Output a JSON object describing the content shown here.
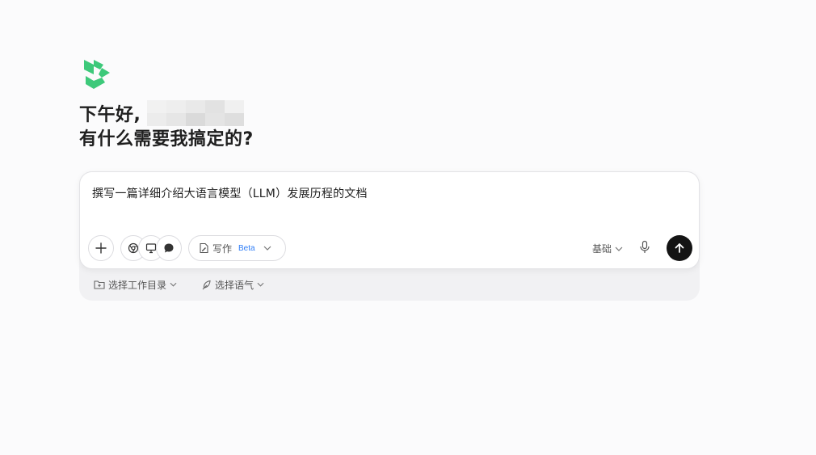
{
  "greeting": {
    "line1": "下午好,",
    "line2": "有什么需要我搞定的?"
  },
  "composer": {
    "prompt": "撰写一篇详细介绍大语言模型（LLM）发展历程的文档",
    "write_label": "写作",
    "write_badge": "Beta",
    "mode": "基础",
    "work_dir_label": "选择工作目录",
    "tone_label": "选择语气"
  },
  "colors": {
    "logo": "#3dc97a",
    "send": "#141414",
    "beta": "#2f7df6"
  },
  "icons": [
    "logo-icon",
    "plus-icon",
    "browser-icon",
    "monitor-icon",
    "chat-icon",
    "write-doc-icon",
    "chevron-down-icon",
    "mic-icon",
    "arrow-up-icon",
    "folder-plus-icon",
    "feather-icon"
  ]
}
